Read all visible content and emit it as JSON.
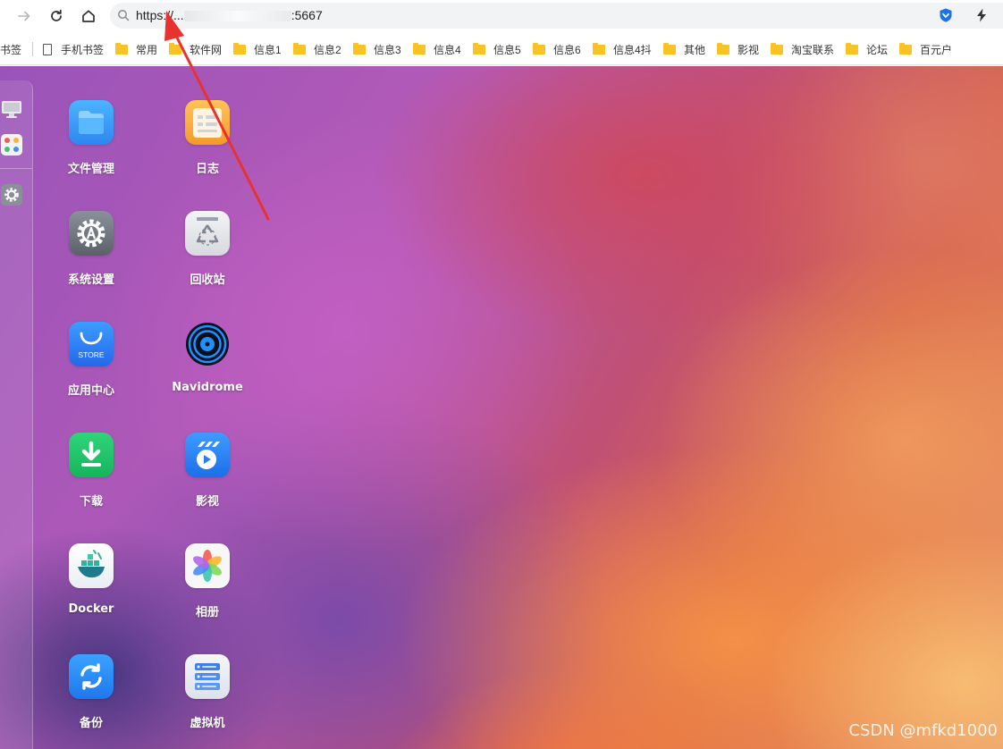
{
  "browser": {
    "url_prefix": "https://...",
    "url_suffix": ":5667"
  },
  "bookmarks": [
    {
      "label": "书签",
      "kind": "text"
    },
    {
      "label": "手机书签",
      "kind": "page"
    },
    {
      "label": "常用",
      "kind": "folder"
    },
    {
      "label": "软件网",
      "kind": "folder"
    },
    {
      "label": "信息1",
      "kind": "folder"
    },
    {
      "label": "信息2",
      "kind": "folder"
    },
    {
      "label": "信息3",
      "kind": "folder"
    },
    {
      "label": "信息4",
      "kind": "folder"
    },
    {
      "label": "信息5",
      "kind": "folder"
    },
    {
      "label": "信息6",
      "kind": "folder"
    },
    {
      "label": "信息4抖",
      "kind": "folder"
    },
    {
      "label": "其他",
      "kind": "folder"
    },
    {
      "label": "影视",
      "kind": "folder"
    },
    {
      "label": "淘宝联系",
      "kind": "folder"
    },
    {
      "label": "论坛",
      "kind": "folder"
    },
    {
      "label": "百元户",
      "kind": "folder"
    }
  ],
  "dock": {
    "items": [
      {
        "icon": "monitor-icon"
      },
      {
        "icon": "app-grid-icon"
      },
      {
        "icon": "gear-icon"
      }
    ]
  },
  "apps": [
    {
      "label": "文件管理",
      "icon": "folder-icon"
    },
    {
      "label": "日志",
      "icon": "log-icon"
    },
    {
      "label": "系统设置",
      "icon": "settings-icon"
    },
    {
      "label": "回收站",
      "icon": "recycle-bin-icon"
    },
    {
      "label": "应用中心",
      "icon": "store-icon",
      "icon_text": "STORE"
    },
    {
      "label": "Navidrome",
      "icon": "vinyl-record-icon"
    },
    {
      "label": "下载",
      "icon": "download-icon"
    },
    {
      "label": "影视",
      "icon": "video-icon"
    },
    {
      "label": "Docker",
      "icon": "docker-icon"
    },
    {
      "label": "相册",
      "icon": "photos-icon"
    },
    {
      "label": "备份",
      "icon": "backup-icon"
    },
    {
      "label": "虚拟机",
      "icon": "virtual-machine-icon"
    }
  ],
  "watermark": "CSDN @mfkd1000",
  "colors": {
    "annotation_arrow": "#e8322e",
    "bookmark_folder": "#f7c325"
  }
}
